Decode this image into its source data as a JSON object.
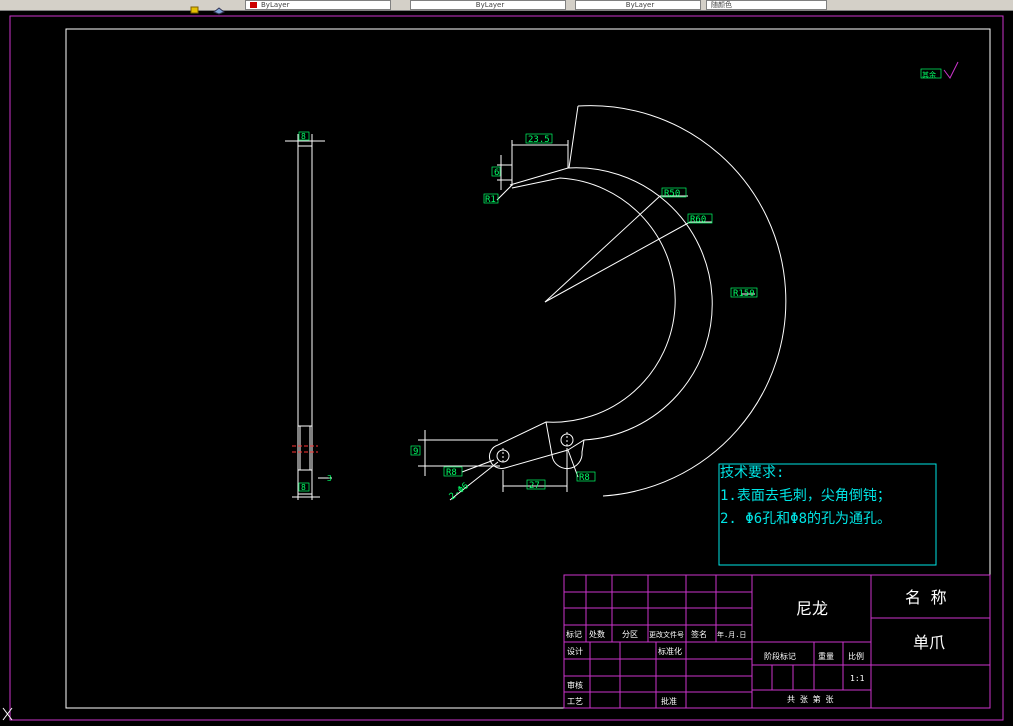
{
  "toolbar": {
    "layer_combo_1": "ByLayer",
    "layer_combo_2": "ByLayer",
    "layer_combo_3": "ByLayer",
    "color_combo": "随颜色",
    "layer_color": "#cc0000"
  },
  "drawing": {
    "dims": {
      "side_width": "8",
      "side_thick": "3",
      "side_depth": "8",
      "d_23_5": "23.5",
      "d_6": "6",
      "d_r1": "R1",
      "r50": "R50",
      "r60": "R60",
      "r150": "R150",
      "d_9": "9",
      "r8": "R8",
      "phi6": "2-Φ6",
      "d_27": "27",
      "r8_2": "R8"
    },
    "roughness_label": "其余"
  },
  "tech": {
    "title": "技术要求:",
    "line1": "1.表面去毛刺，尖角倒钝；",
    "line2": "2. Φ6孔和Φ8的孔为通孔。"
  },
  "title_block": {
    "material": "尼龙",
    "name_label": "名  称",
    "part_name": "单爪",
    "h_mark": "标记",
    "h_count": "处数",
    "h_zone": "分区",
    "h_doc": "更改文件号",
    "h_sign": "签名",
    "h_date": "年.月.日",
    "design": "设计",
    "standard": "标准化",
    "stage": "阶段标记",
    "weight": "重量",
    "scale_label": "比例",
    "scale": "1:1",
    "review": "审核",
    "process": "工艺",
    "approve": "批准",
    "sheets": "共 张 第 张"
  },
  "colors": {
    "background": "#000000",
    "frame": "#cc33cc",
    "lines": "#ffffff",
    "dim_text": "#00ff66",
    "tech_text": "#00e5e5"
  }
}
